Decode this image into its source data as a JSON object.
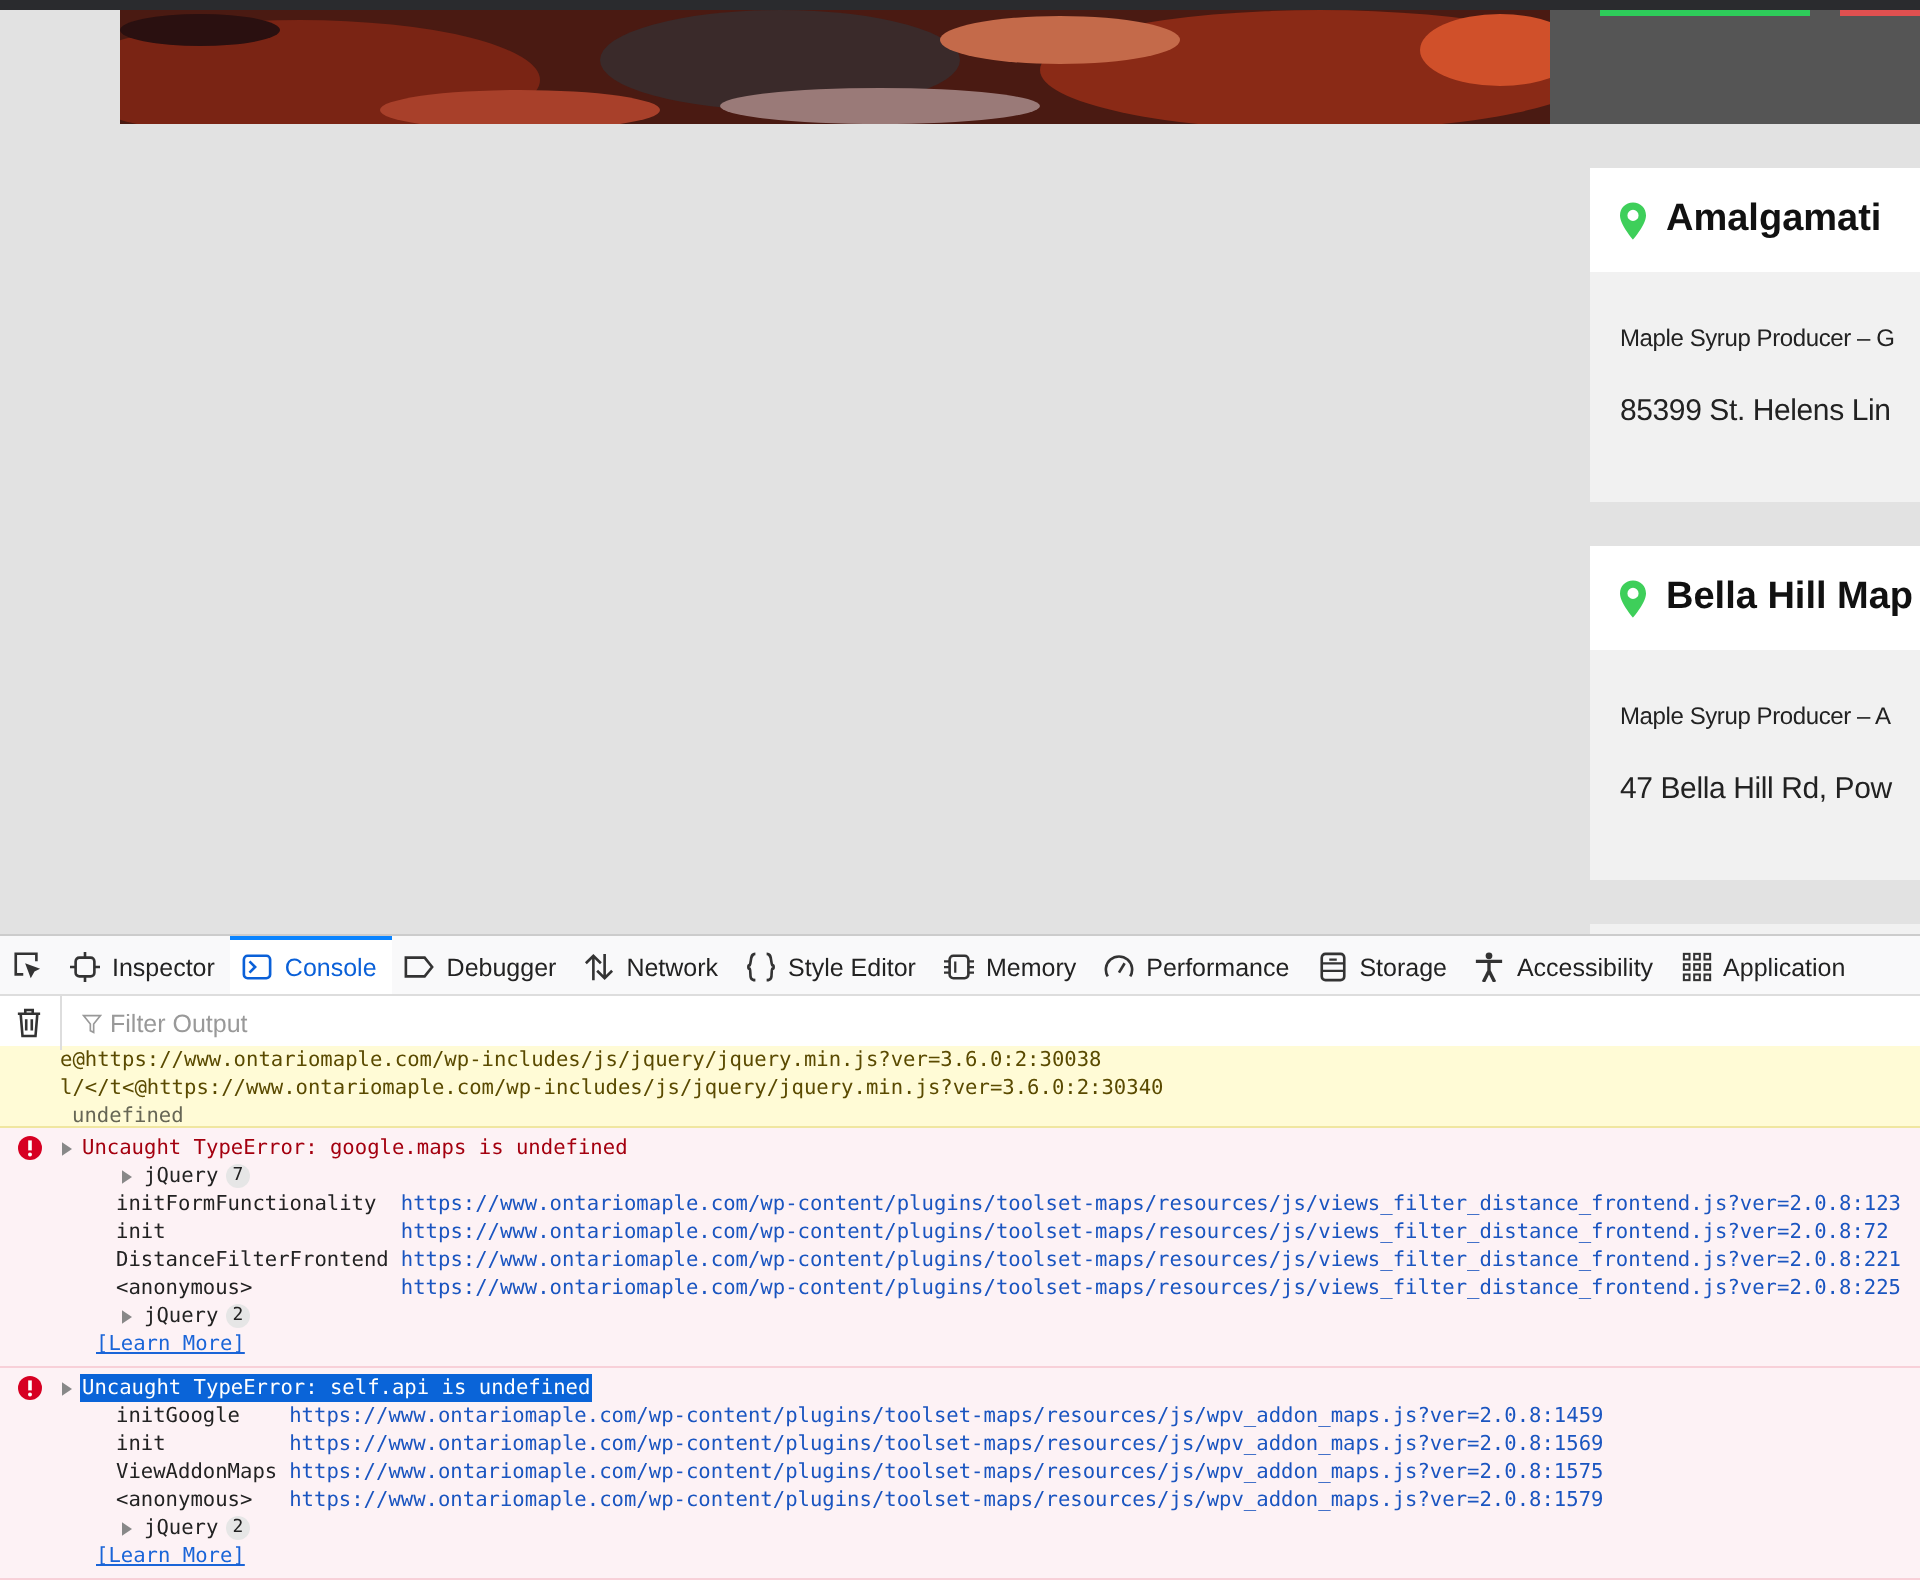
{
  "page": {
    "cards": [
      {
        "title": "Amalgamati",
        "category": "Maple Syrup Producer – G",
        "address": "85399 St. Helens Lin"
      },
      {
        "title": "Bella Hill Map",
        "category": "Maple Syrup Producer – A",
        "address": "47 Bella Hill Rd, Pow"
      }
    ]
  },
  "devtools": {
    "tabs": [
      {
        "label": "Inspector",
        "selected": false
      },
      {
        "label": "Console",
        "selected": true
      },
      {
        "label": "Debugger",
        "selected": false
      },
      {
        "label": "Network",
        "selected": false
      },
      {
        "label": "Style Editor",
        "selected": false
      },
      {
        "label": "Memory",
        "selected": false
      },
      {
        "label": "Performance",
        "selected": false
      },
      {
        "label": "Storage",
        "selected": false
      },
      {
        "label": "Accessibility",
        "selected": false
      },
      {
        "label": "Application",
        "selected": false
      }
    ],
    "filter": {
      "placeholder": "Filter Output"
    },
    "messages": [
      {
        "kind": "trace",
        "lines": [
          "e@https://www.ontariomaple.com/wp-includes/js/jquery/jquery.min.js?ver=3.6.0:2:30038",
          "l/</t<@https://www.ontariomaple.com/wp-includes/js/jquery/jquery.min.js?ver=3.6.0:2:30340"
        ],
        "result": "undefined"
      },
      {
        "kind": "error",
        "text": "Uncaught TypeError: google.maps is undefined",
        "selected": false,
        "frames": [
          {
            "kind": "group",
            "name": "jQuery",
            "count": "7"
          },
          {
            "kind": "frame",
            "name": "initFormFunctionality",
            "location": "https://www.ontariomaple.com/wp-content/plugins/toolset-maps/resources/js/views_filter_distance_frontend.js?ver=2.0.8:123"
          },
          {
            "kind": "frame",
            "name": "init",
            "location": "https://www.ontariomaple.com/wp-content/plugins/toolset-maps/resources/js/views_filter_distance_frontend.js?ver=2.0.8:72"
          },
          {
            "kind": "frame",
            "name": "DistanceFilterFrontend",
            "location": "https://www.ontariomaple.com/wp-content/plugins/toolset-maps/resources/js/views_filter_distance_frontend.js?ver=2.0.8:221"
          },
          {
            "kind": "frame",
            "name": "<anonymous>",
            "location": "https://www.ontariomaple.com/wp-content/plugins/toolset-maps/resources/js/views_filter_distance_frontend.js?ver=2.0.8:225"
          },
          {
            "kind": "group",
            "name": "jQuery",
            "count": "2"
          }
        ],
        "link": "[Learn More]"
      },
      {
        "kind": "error",
        "text": "Uncaught TypeError: self.api is undefined",
        "selected": true,
        "frames": [
          {
            "kind": "frame",
            "name": "initGoogle",
            "location": "https://www.ontariomaple.com/wp-content/plugins/toolset-maps/resources/js/wpv_addon_maps.js?ver=2.0.8:1459"
          },
          {
            "kind": "frame",
            "name": "init",
            "location": "https://www.ontariomaple.com/wp-content/plugins/toolset-maps/resources/js/wpv_addon_maps.js?ver=2.0.8:1569"
          },
          {
            "kind": "frame",
            "name": "ViewAddonMaps",
            "location": "https://www.ontariomaple.com/wp-content/plugins/toolset-maps/resources/js/wpv_addon_maps.js?ver=2.0.8:1575"
          },
          {
            "kind": "frame",
            "name": "<anonymous>",
            "location": "https://www.ontariomaple.com/wp-content/plugins/toolset-maps/resources/js/wpv_addon_maps.js?ver=2.0.8:1579"
          },
          {
            "kind": "group",
            "name": "jQuery",
            "count": "2"
          }
        ],
        "link": "[Learn More]"
      }
    ]
  }
}
